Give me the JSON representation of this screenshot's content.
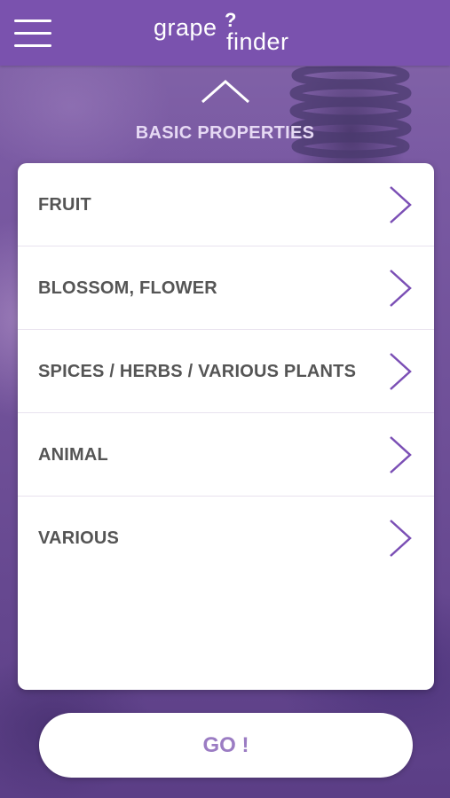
{
  "header": {
    "logo_part1": "grape",
    "logo_mark": "?",
    "logo_part2": "finder",
    "menu_icon": "hamburger-menu-icon"
  },
  "section": {
    "collapse_icon": "chevron-up-icon",
    "title": "BASIC PROPERTIES"
  },
  "categories": [
    {
      "label": "FRUIT",
      "icon": "chevron-right-icon"
    },
    {
      "label": "BLOSSOM, FLOWER",
      "icon": "chevron-right-icon"
    },
    {
      "label": "SPICES / HERBS / VARIOUS PLANTS",
      "icon": "chevron-right-icon"
    },
    {
      "label": "ANIMAL",
      "icon": "chevron-right-icon"
    },
    {
      "label": "VARIOUS",
      "icon": "chevron-right-icon"
    }
  ],
  "go_button": {
    "label": "GO !"
  },
  "colors": {
    "brand_purple": "#7a52ae",
    "chevron": "#7b4fb5",
    "go_text": "#9b7cc3",
    "row_text": "#555555"
  }
}
